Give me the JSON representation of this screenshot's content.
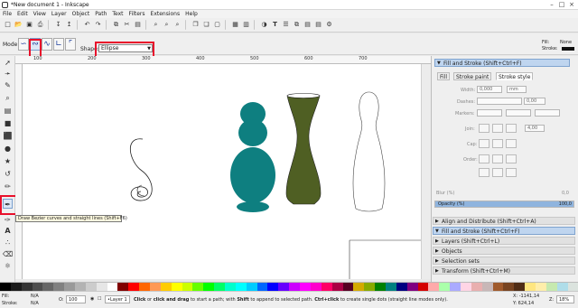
{
  "window": {
    "title": "*New document 1 - Inkscape"
  },
  "menu": [
    "File",
    "Edit",
    "View",
    "Layer",
    "Object",
    "Path",
    "Text",
    "Filters",
    "Extensions",
    "Help"
  ],
  "toolcontrols": {
    "mode_label": "Mode:",
    "shape_label": "Shape:",
    "shape_value": "Ellipse"
  },
  "style_indicator": {
    "fill_label": "Fill:",
    "fill_value": "None",
    "stroke_label": "Stroke:"
  },
  "ruler": {
    "labels": [
      "100",
      "200",
      "300",
      "400",
      "500",
      "600",
      "700"
    ]
  },
  "tooltip": "Draw Bezier curves and straight lines (Shift+F6)",
  "panel": {
    "header": "Fill and Stroke (Shift+Ctrl+F)",
    "tabs": [
      "Fill",
      "Stroke paint",
      "Stroke style"
    ],
    "width_label": "Width:",
    "width_value": "0,000",
    "width_unit": "mm",
    "dashes_label": "Dashes:",
    "dashes_value": "0,00",
    "markers_label": "Markers:",
    "join_label": "Join:",
    "join_value": "4,00",
    "cap_label": "Cap:",
    "order_label": "Order:",
    "blur_label": "Blur (%)",
    "blur_value": "0,0",
    "opacity_label": "Opacity (%)",
    "opacity_value": "100,0",
    "opacity_level": 1.0,
    "docks": [
      {
        "label": "Align and Distribute (Shift+Ctrl+A)",
        "active": false
      },
      {
        "label": "Fill and Stroke (Shift+Ctrl+F)",
        "active": true
      },
      {
        "label": "Layers (Shift+Ctrl+L)",
        "active": false
      },
      {
        "label": "Objects",
        "active": false
      },
      {
        "label": "Selection sets",
        "active": false
      },
      {
        "label": "Transform (Shift+Ctrl+M)",
        "active": false
      }
    ]
  },
  "colors": {
    "teal": "#0e7f80",
    "olive": "#4f5f23",
    "white_shape": "#ffffff",
    "highlight": "#e8102b"
  },
  "palette": [
    "#000000",
    "#1a1a1a",
    "#333333",
    "#4d4d4d",
    "#666666",
    "#808080",
    "#999999",
    "#b3b3b3",
    "#cccccc",
    "#e6e6e6",
    "#ffffff",
    "#800000",
    "#ff0000",
    "#ff6600",
    "#ff9955",
    "#ffcc00",
    "#ffff00",
    "#ccff00",
    "#66ff00",
    "#00ff00",
    "#00ff66",
    "#00ffcc",
    "#00ffff",
    "#00ccff",
    "#0066ff",
    "#0000ff",
    "#6600ff",
    "#cc00ff",
    "#ff00ff",
    "#ff00cc",
    "#ff0066",
    "#aa0044",
    "#550022",
    "#d4aa00",
    "#88aa00",
    "#008000",
    "#008080",
    "#000080",
    "#800080",
    "#d40000",
    "#ffaaaa",
    "#aaffaa",
    "#aaaaff",
    "#ffd5e5",
    "#e9afaf",
    "#c8b7b7",
    "#a05a2c",
    "#784421",
    "#502d16",
    "#ffe680",
    "#ffeeaa",
    "#c6e9af",
    "#afdde9",
    "#dbe3de"
  ],
  "status": {
    "fill_label": "Fill:",
    "fill_value": "N/A",
    "stroke_label": "Stroke:",
    "stroke_value": "N/A",
    "opacity_label": "O:",
    "opacity_value": "100",
    "layer_value": "•Layer 1",
    "message_bold1": "Click",
    "message_1": " or ",
    "message_bold2": "click and drag",
    "message_2": " to start a path; with ",
    "message_bold3": "Shift",
    "message_3": " to append to selected path. ",
    "message_bold4": "Ctrl+click",
    "message_4": " to create single dots (straight line modes only).",
    "coord_x": "X: -1141,14",
    "coord_y": "Y: 624,14",
    "zoom_label": "Z:",
    "zoom_value": "18%"
  }
}
